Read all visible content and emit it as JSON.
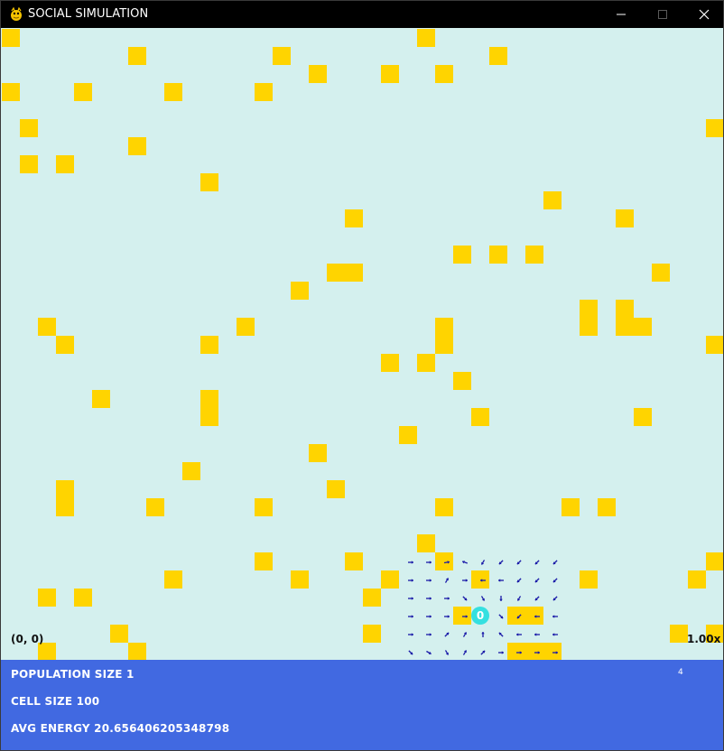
{
  "window": {
    "title": "SOCIAL SIMULATION",
    "app_icon": "pygame-snake-icon",
    "controls": [
      "minimize-icon",
      "maximize-icon",
      "close-icon"
    ]
  },
  "simulation": {
    "colors": {
      "background": "#d4f0ee",
      "food": "#ffd400",
      "agent": "#35e0e0",
      "arrow": "#1a1aa8",
      "info_bar": "#4169e1"
    },
    "origin_label": "(0, 0)",
    "zoom_label": "1.00x",
    "agent": {
      "id_label": "0"
    }
  },
  "info": {
    "population_label": "POPULATION SIZE",
    "population_value": "1",
    "cell_size_label": "CELL SIZE",
    "cell_size_value": "100",
    "avg_energy_label": "AVG ENERGY",
    "avg_energy_value": "20.656406205348798",
    "corner_value": "4"
  }
}
